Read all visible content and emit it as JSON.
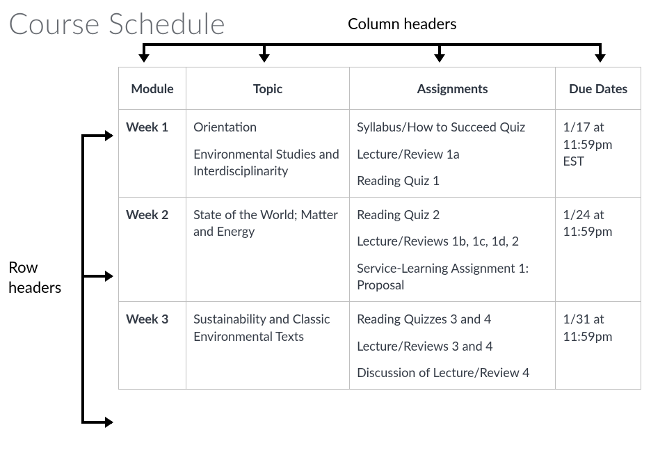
{
  "title": "Course Schedule",
  "annotations": {
    "column_label": "Column headers",
    "row_label": "Row headers"
  },
  "table": {
    "headers": [
      "Module",
      "Topic",
      "Assignments",
      "Due Dates"
    ],
    "rows": [
      {
        "module": "Week 1",
        "topic": [
          "Orientation",
          "Environmental Studies and Interdisciplinarity"
        ],
        "assignments": [
          "Syllabus/How to Succeed Quiz",
          "Lecture/Review 1a",
          "Reading Quiz 1"
        ],
        "due": "1/17 at 11:59pm EST"
      },
      {
        "module": "Week 2",
        "topic": [
          "State of the World; Matter and Energy"
        ],
        "assignments": [
          "Reading Quiz 2",
          "Lecture/Reviews 1b, 1c, 1d, 2",
          "Service-Learning Assignment 1: Proposal"
        ],
        "due": "1/24 at 11:59pm"
      },
      {
        "module": "Week 3",
        "topic": [
          "Sustainability and Classic Environmental Texts"
        ],
        "assignments": [
          "Reading Quizzes 3 and 4",
          "Lecture/Reviews 3 and 4",
          "Discussion of Lecture/Review 4"
        ],
        "due": "1/31 at 11:59pm"
      }
    ]
  }
}
